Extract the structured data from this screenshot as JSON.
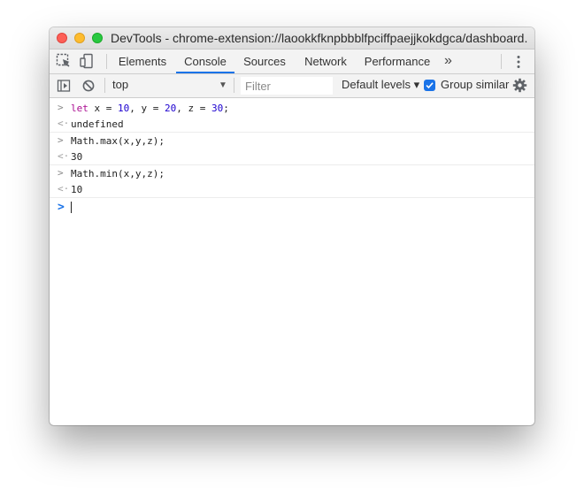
{
  "window": {
    "title": "DevTools - chrome-extension://laookkfknpbbblfpciffpaejjkokdgca/dashboard...."
  },
  "tabs": [
    {
      "label": "Elements",
      "active": false
    },
    {
      "label": "Console",
      "active": true
    },
    {
      "label": "Sources",
      "active": false
    },
    {
      "label": "Network",
      "active": false
    },
    {
      "label": "Performance",
      "active": false
    }
  ],
  "tabs_overflow": "»",
  "toolbar": {
    "context": "top",
    "filter_placeholder": "Filter",
    "levels": "Default levels ▾",
    "group_similar": "Group similar",
    "group_similar_checked": true
  },
  "console": {
    "entries": [
      {
        "input": {
          "kw": "let",
          "parts": [
            " x = ",
            "10",
            ", y = ",
            "20",
            ", z = ",
            "30",
            ";"
          ]
        },
        "result": "undefined"
      },
      {
        "input_text": "Math.max(x,y,z);",
        "result": "30"
      },
      {
        "input_text": "Math.min(x,y,z);",
        "result": "10"
      }
    ],
    "input_arrow": ">",
    "result_arrow": "<·",
    "prompt_arrow": ">"
  },
  "colors": {
    "accent": "#1a73e8",
    "keyword": "#aa0d91",
    "number": "#1c00cf"
  }
}
